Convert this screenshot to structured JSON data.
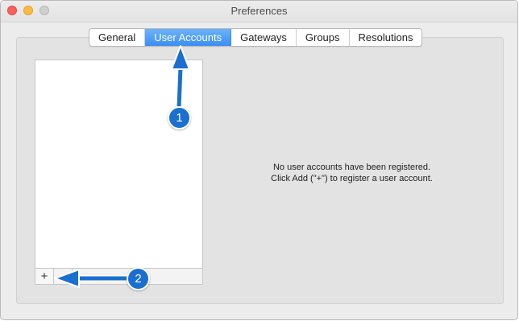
{
  "window": {
    "title": "Preferences"
  },
  "tabs": [
    {
      "label": "General",
      "active": false
    },
    {
      "label": "User Accounts",
      "active": true
    },
    {
      "label": "Gateways",
      "active": false
    },
    {
      "label": "Groups",
      "active": false
    },
    {
      "label": "Resolutions",
      "active": false
    }
  ],
  "accounts_list": {
    "add_label": "+",
    "items": []
  },
  "empty_state": {
    "line1": "No user accounts have been registered.",
    "line2": "Click Add (\"+\") to register a user account."
  },
  "annotations": {
    "badge1": "1",
    "badge2": "2",
    "color": "#1b6fd0"
  },
  "colors": {
    "accent": "#3b8ef5",
    "close": "#fc605c",
    "minimize": "#fdbc40",
    "zoom_disabled": "#cfcfcf"
  }
}
